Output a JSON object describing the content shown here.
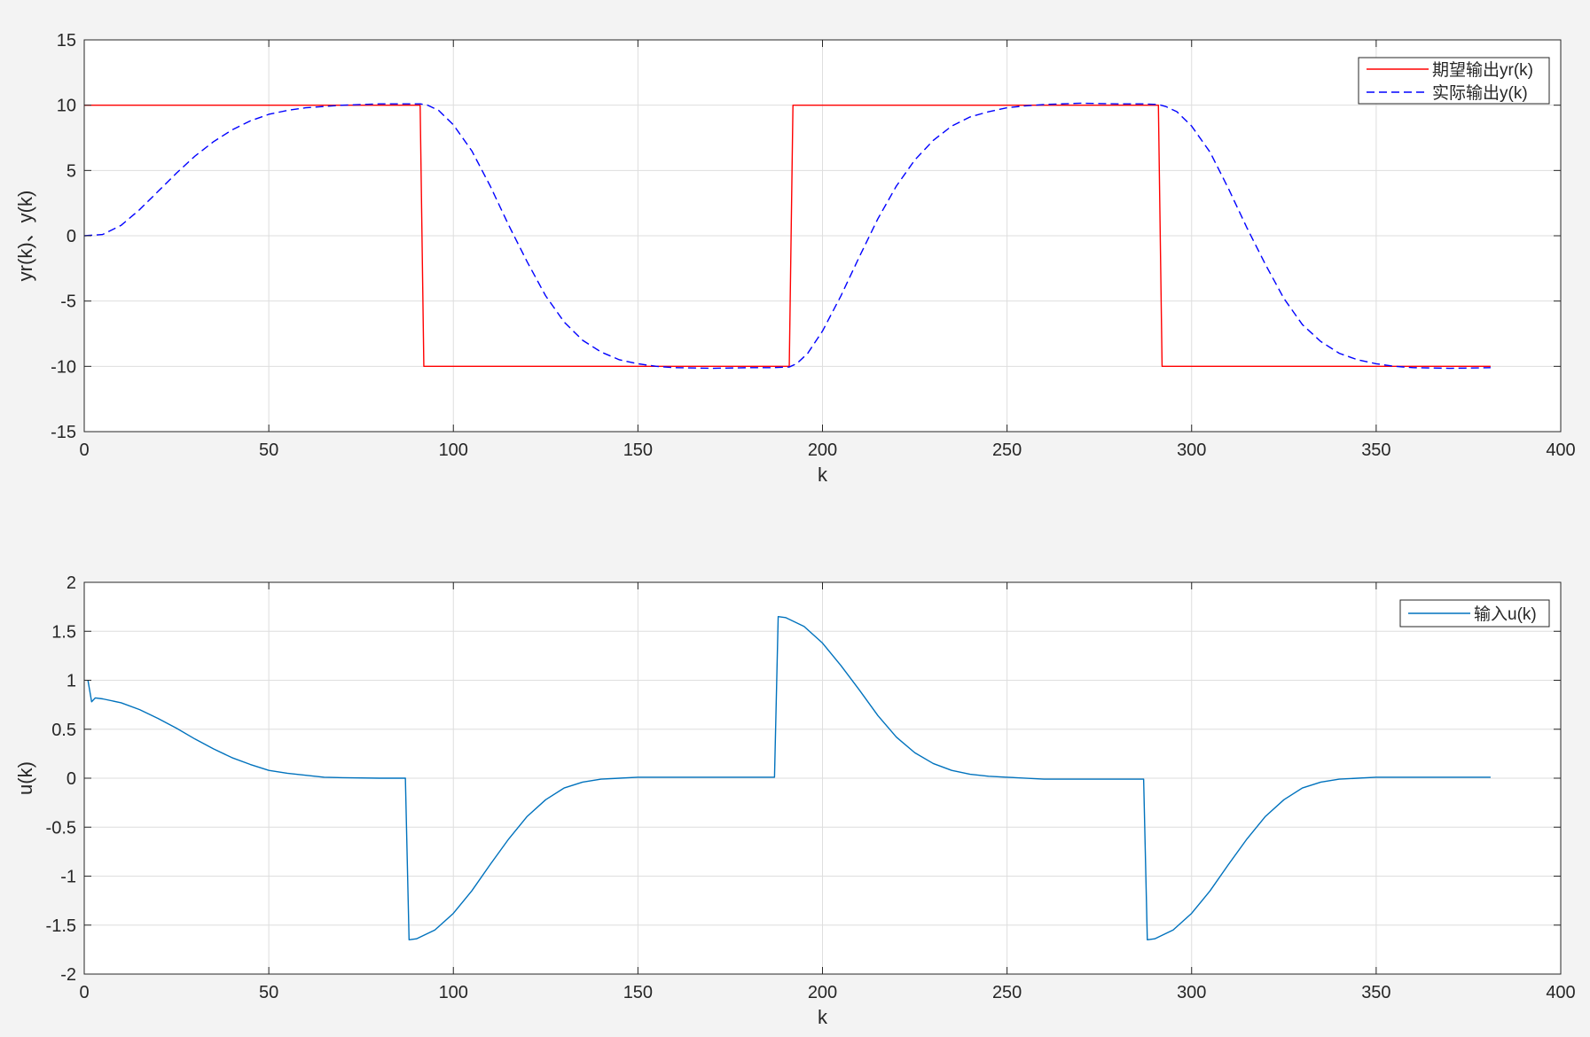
{
  "chart_data": [
    {
      "type": "line",
      "title": "",
      "xlabel": "k",
      "ylabel": "yr(k)、y(k)",
      "xlim": [
        0,
        400
      ],
      "ylim": [
        -15,
        15
      ],
      "xticks": [
        0,
        50,
        100,
        150,
        200,
        250,
        300,
        350,
        400
      ],
      "yticks": [
        -15,
        -10,
        -5,
        0,
        5,
        10,
        15
      ],
      "grid": true,
      "legend_position": "top-right",
      "series": [
        {
          "name": "期望输出yr(k)",
          "color": "#ff0000",
          "style": "solid",
          "points": [
            [
              0,
              10
            ],
            [
              91,
              10
            ],
            [
              92,
              -10
            ],
            [
              191,
              -10
            ],
            [
              192,
              10
            ],
            [
              291,
              10
            ],
            [
              292,
              -10
            ],
            [
              381,
              -10
            ]
          ]
        },
        {
          "name": "实际输出y(k)",
          "color": "#0000ff",
          "style": "dashed",
          "points": [
            [
              0,
              0
            ],
            [
              5,
              0.1
            ],
            [
              10,
              0.8
            ],
            [
              15,
              2.0
            ],
            [
              20,
              3.4
            ],
            [
              25,
              4.8
            ],
            [
              30,
              6.1
            ],
            [
              35,
              7.2
            ],
            [
              40,
              8.1
            ],
            [
              45,
              8.8
            ],
            [
              50,
              9.3
            ],
            [
              55,
              9.6
            ],
            [
              60,
              9.8
            ],
            [
              65,
              9.9
            ],
            [
              70,
              10.0
            ],
            [
              75,
              10.05
            ],
            [
              80,
              10.1
            ],
            [
              85,
              10.1
            ],
            [
              91,
              10.1
            ],
            [
              93,
              10.0
            ],
            [
              96,
              9.6
            ],
            [
              100,
              8.5
            ],
            [
              105,
              6.5
            ],
            [
              110,
              3.8
            ],
            [
              115,
              0.8
            ],
            [
              120,
              -2.0
            ],
            [
              125,
              -4.6
            ],
            [
              130,
              -6.6
            ],
            [
              135,
              -8.0
            ],
            [
              140,
              -8.9
            ],
            [
              145,
              -9.5
            ],
            [
              150,
              -9.8
            ],
            [
              155,
              -10.0
            ],
            [
              160,
              -10.1
            ],
            [
              170,
              -10.15
            ],
            [
              180,
              -10.1
            ],
            [
              186,
              -10.1
            ],
            [
              191,
              -10.05
            ],
            [
              193,
              -9.8
            ],
            [
              196,
              -9.0
            ],
            [
              200,
              -7.3
            ],
            [
              205,
              -4.6
            ],
            [
              210,
              -1.6
            ],
            [
              215,
              1.3
            ],
            [
              220,
              3.8
            ],
            [
              225,
              5.8
            ],
            [
              230,
              7.3
            ],
            [
              235,
              8.4
            ],
            [
              240,
              9.1
            ],
            [
              245,
              9.5
            ],
            [
              250,
              9.8
            ],
            [
              255,
              9.95
            ],
            [
              260,
              10.05
            ],
            [
              270,
              10.15
            ],
            [
              280,
              10.1
            ],
            [
              287,
              10.1
            ],
            [
              291,
              10.05
            ],
            [
              293,
              9.9
            ],
            [
              296,
              9.5
            ],
            [
              300,
              8.4
            ],
            [
              305,
              6.4
            ],
            [
              310,
              3.6
            ],
            [
              315,
              0.6
            ],
            [
              320,
              -2.2
            ],
            [
              325,
              -4.8
            ],
            [
              330,
              -6.8
            ],
            [
              335,
              -8.1
            ],
            [
              340,
              -9.0
            ],
            [
              345,
              -9.5
            ],
            [
              350,
              -9.8
            ],
            [
              355,
              -10.0
            ],
            [
              360,
              -10.1
            ],
            [
              370,
              -10.15
            ],
            [
              381,
              -10.1
            ]
          ]
        }
      ]
    },
    {
      "type": "line",
      "title": "",
      "xlabel": "k",
      "ylabel": "u(k)",
      "xlim": [
        0,
        400
      ],
      "ylim": [
        -2,
        2
      ],
      "xticks": [
        0,
        50,
        100,
        150,
        200,
        250,
        300,
        350,
        400
      ],
      "yticks": [
        -2,
        -1.5,
        -1,
        -0.5,
        0,
        0.5,
        1,
        1.5,
        2
      ],
      "grid": true,
      "legend_position": "top-right",
      "series": [
        {
          "name": "输入u(k)",
          "color": "#0072bd",
          "style": "solid",
          "points": [
            [
              1,
              1.0
            ],
            [
              2,
              0.78
            ],
            [
              3,
              0.82
            ],
            [
              5,
              0.81
            ],
            [
              10,
              0.77
            ],
            [
              15,
              0.7
            ],
            [
              20,
              0.61
            ],
            [
              25,
              0.51
            ],
            [
              30,
              0.4
            ],
            [
              35,
              0.3
            ],
            [
              40,
              0.21
            ],
            [
              45,
              0.14
            ],
            [
              50,
              0.08
            ],
            [
              55,
              0.05
            ],
            [
              60,
              0.03
            ],
            [
              65,
              0.01
            ],
            [
              70,
              0.005
            ],
            [
              80,
              0.0
            ],
            [
              87,
              0.0
            ],
            [
              88,
              -1.65
            ],
            [
              90,
              -1.64
            ],
            [
              95,
              -1.55
            ],
            [
              100,
              -1.38
            ],
            [
              105,
              -1.15
            ],
            [
              110,
              -0.88
            ],
            [
              115,
              -0.62
            ],
            [
              120,
              -0.39
            ],
            [
              125,
              -0.22
            ],
            [
              130,
              -0.1
            ],
            [
              135,
              -0.04
            ],
            [
              140,
              -0.01
            ],
            [
              145,
              0.0
            ],
            [
              150,
              0.01
            ],
            [
              160,
              0.01
            ],
            [
              170,
              0.01
            ],
            [
              187,
              0.01
            ],
            [
              188,
              1.65
            ],
            [
              190,
              1.64
            ],
            [
              195,
              1.55
            ],
            [
              200,
              1.38
            ],
            [
              205,
              1.15
            ],
            [
              210,
              0.9
            ],
            [
              215,
              0.64
            ],
            [
              220,
              0.42
            ],
            [
              225,
              0.26
            ],
            [
              230,
              0.15
            ],
            [
              235,
              0.08
            ],
            [
              240,
              0.04
            ],
            [
              245,
              0.02
            ],
            [
              250,
              0.01
            ],
            [
              260,
              -0.01
            ],
            [
              270,
              -0.01
            ],
            [
              287,
              -0.01
            ],
            [
              288,
              -1.65
            ],
            [
              290,
              -1.64
            ],
            [
              295,
              -1.55
            ],
            [
              300,
              -1.38
            ],
            [
              305,
              -1.15
            ],
            [
              310,
              -0.88
            ],
            [
              315,
              -0.62
            ],
            [
              320,
              -0.39
            ],
            [
              325,
              -0.22
            ],
            [
              330,
              -0.1
            ],
            [
              335,
              -0.04
            ],
            [
              340,
              -0.01
            ],
            [
              345,
              0.0
            ],
            [
              350,
              0.01
            ],
            [
              360,
              0.01
            ],
            [
              381,
              0.01
            ]
          ]
        }
      ]
    }
  ]
}
